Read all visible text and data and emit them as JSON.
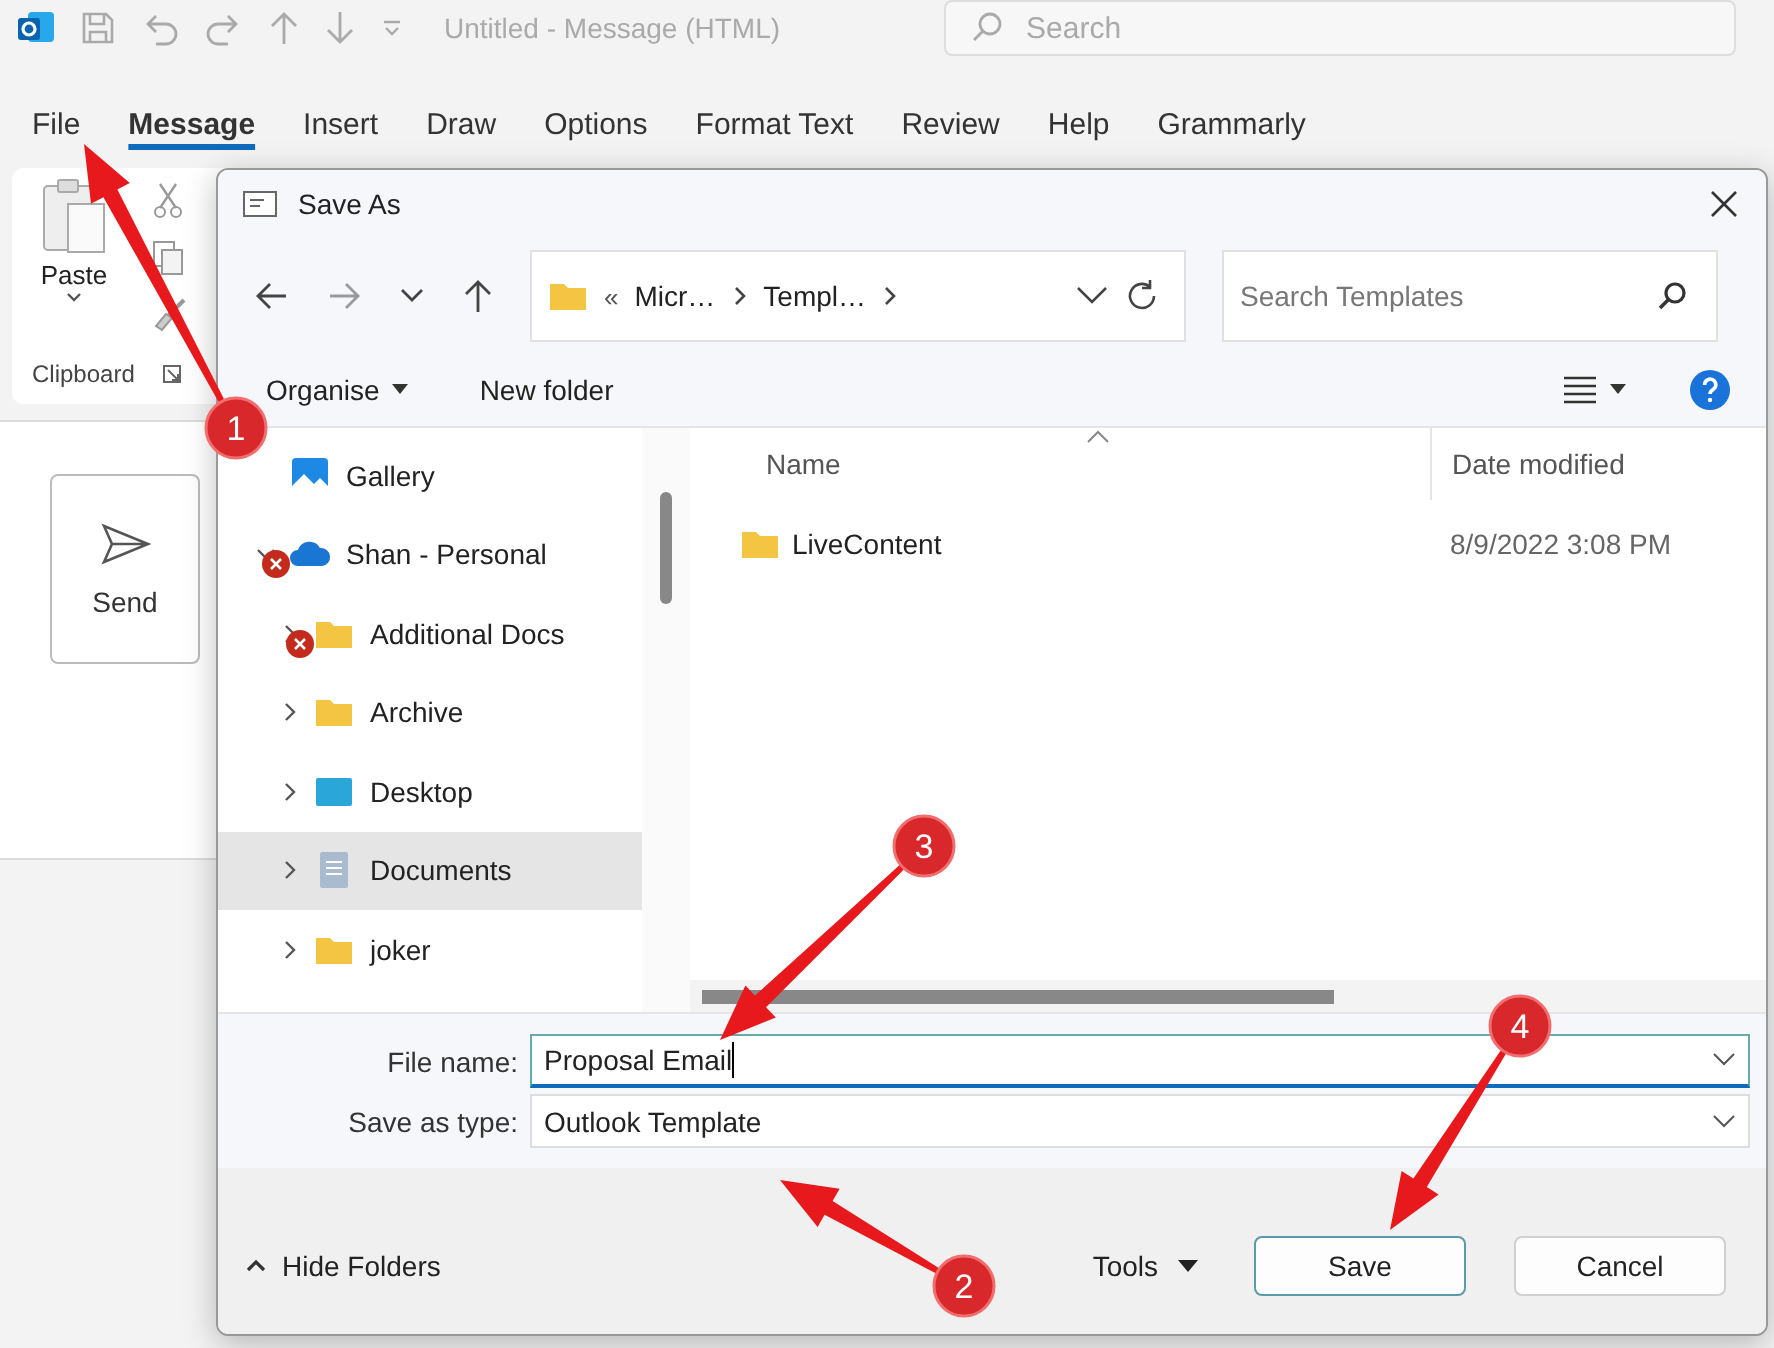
{
  "app": {
    "title": "Untitled  -  Message (HTML)",
    "search_placeholder": "Search"
  },
  "ribbon_tabs": [
    {
      "label": "File",
      "selected": false
    },
    {
      "label": "Message",
      "selected": true
    },
    {
      "label": "Insert",
      "selected": false
    },
    {
      "label": "Draw",
      "selected": false
    },
    {
      "label": "Options",
      "selected": false
    },
    {
      "label": "Format Text",
      "selected": false
    },
    {
      "label": "Review",
      "selected": false
    },
    {
      "label": "Help",
      "selected": false
    },
    {
      "label": "Grammarly",
      "selected": false
    }
  ],
  "clipboard": {
    "paste": "Paste",
    "group": "Clipboard"
  },
  "send": "Send",
  "dialog": {
    "title": "Save As",
    "overflow": "«",
    "path": [
      "Micr…",
      "Templ…"
    ],
    "search_placeholder": "Search Templates",
    "organise": "Organise",
    "new_folder": "New folder",
    "nav": [
      {
        "label": "Gallery",
        "kind": "gallery",
        "selected": false,
        "error": false
      },
      {
        "label": "Shan - Personal",
        "kind": "cloud",
        "selected": false,
        "error": true,
        "expanded": true,
        "children": [
          {
            "label": "Additional Docs",
            "kind": "folder",
            "selected": false,
            "error": true,
            "expanded": false
          },
          {
            "label": "Archive",
            "kind": "folder",
            "selected": false,
            "error": false,
            "expanded": false
          },
          {
            "label": "Desktop",
            "kind": "desktop",
            "selected": false,
            "error": false,
            "expanded": false
          },
          {
            "label": "Documents",
            "kind": "documents",
            "selected": true,
            "error": false,
            "expanded": false
          },
          {
            "label": "joker",
            "kind": "folder",
            "selected": false,
            "error": false,
            "expanded": false
          }
        ]
      }
    ],
    "columns": [
      "Name",
      "Date modified"
    ],
    "files": [
      {
        "name": "LiveContent",
        "date": "8/9/2022 3:08 PM"
      }
    ],
    "file_name": {
      "label": "File name:",
      "value": "Proposal Email"
    },
    "save_type": {
      "label": "Save as type:",
      "value": "Outlook Template"
    },
    "hide_folders": "Hide Folders",
    "tools": "Tools",
    "buttons": [
      "Save",
      "Cancel"
    ]
  },
  "callouts": [
    {
      "label": "1"
    },
    {
      "label": "2"
    },
    {
      "label": "3"
    },
    {
      "label": "4"
    }
  ]
}
